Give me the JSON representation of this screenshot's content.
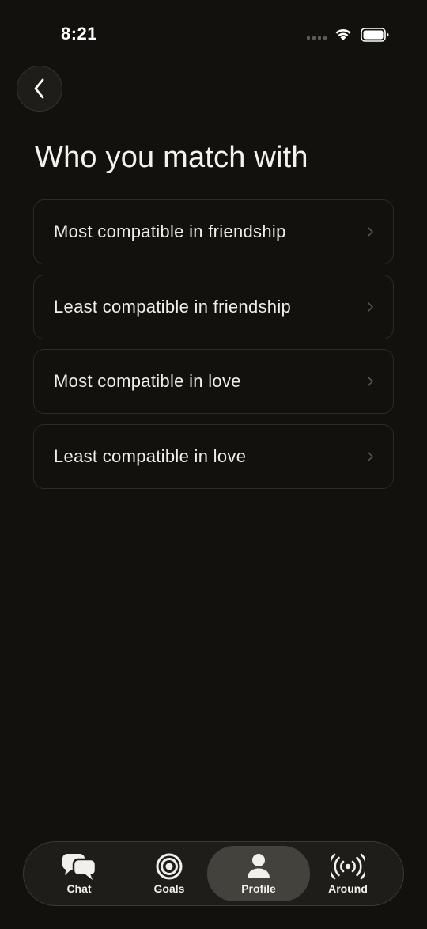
{
  "status_bar": {
    "time": "8:21",
    "signal_icon": "cellular-signal-icon",
    "wifi_icon": "wifi-icon",
    "battery_icon": "battery-icon"
  },
  "header": {
    "back_icon": "chevron-left-icon",
    "title": "Who you match with"
  },
  "options": [
    {
      "label": "Most compatible in friendship"
    },
    {
      "label": "Least compatible in friendship"
    },
    {
      "label": "Most compatible in love"
    },
    {
      "label": "Least compatible in love"
    }
  ],
  "tab_bar": {
    "tabs": [
      {
        "label": "Chat",
        "icon": "chat-bubbles-icon",
        "active": false
      },
      {
        "label": "Goals",
        "icon": "target-icon",
        "active": false
      },
      {
        "label": "Profile",
        "icon": "person-icon",
        "active": true
      },
      {
        "label": "Around",
        "icon": "broadcast-icon",
        "active": false
      }
    ]
  },
  "colors": {
    "background": "#12110d",
    "card_border": "#2d2c27",
    "text": "#f0eee8",
    "tab_bar": "#1e1d1a",
    "tab_active": "#43423d"
  }
}
